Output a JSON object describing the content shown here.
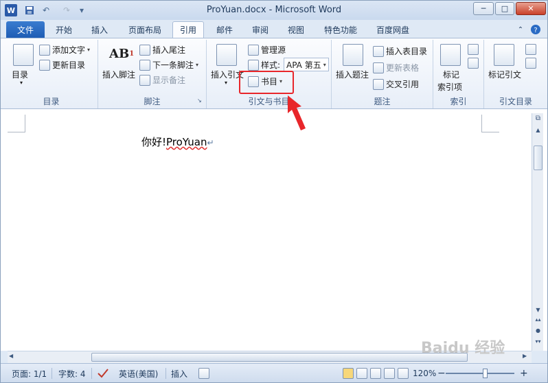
{
  "window": {
    "title": "ProYuan.docx - Microsoft Word",
    "app_icon": "W",
    "qat": {
      "save_icon": "save-icon",
      "undo_icon": "↶",
      "redo_icon": "↷",
      "customize_icon": "▾"
    }
  },
  "tabs": [
    {
      "label": "文件"
    },
    {
      "label": "开始"
    },
    {
      "label": "插入"
    },
    {
      "label": "页面布局"
    },
    {
      "label": "引用",
      "active": true
    },
    {
      "label": "邮件"
    },
    {
      "label": "审阅"
    },
    {
      "label": "视图"
    },
    {
      "label": "特色功能"
    },
    {
      "label": "百度网盘"
    }
  ],
  "ribbon": {
    "toc": {
      "label": "目录",
      "toc_button": "目录",
      "add_text": "添加文字",
      "update_toc": "更新目录"
    },
    "footnotes": {
      "label": "脚注",
      "insert_footnote": "插入脚注",
      "ab_glyph": "AB",
      "insert_endnote": "插入尾注",
      "next_footnote": "下一条脚注",
      "show_notes": "显示备注"
    },
    "citations": {
      "label": "引文与书目",
      "insert_citation": "插入引文",
      "manage_sources": "管理源",
      "style_label": "样式:",
      "style_value": "APA 第五",
      "bibliography": "书目"
    },
    "captions": {
      "label": "题注",
      "insert_caption": "插入题注",
      "insert_table_of_figures": "插入表目录",
      "update_table": "更新表格",
      "cross_reference": "交叉引用"
    },
    "index": {
      "label": "索引",
      "mark_entry_line1": "标记",
      "mark_entry_line2": "索引项"
    },
    "toa": {
      "label": "引文目录",
      "mark_citation": "标记引文"
    }
  },
  "document": {
    "text_prefix": "你好!",
    "text_word": "ProYuan",
    "paragraph_mark": "↵"
  },
  "status_bar": {
    "page": "页面: 1/1",
    "words": "字数: 4",
    "language": "英语(美国)",
    "mode": "插入",
    "zoom": "120%",
    "zoom_minus": "−",
    "zoom_plus": "+"
  },
  "watermark": "Baidu 经验",
  "colors": {
    "highlight": "#e8262a",
    "file_tab": "#2a6bc4"
  }
}
